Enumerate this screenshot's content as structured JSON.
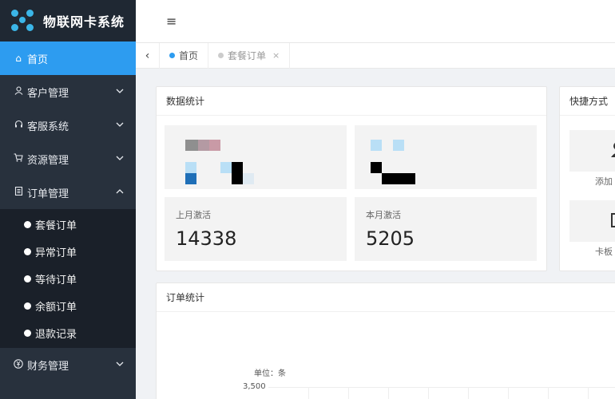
{
  "app": {
    "title": "物联网卡系统"
  },
  "sidebar": {
    "items": [
      {
        "label": "首页",
        "icon": "home-icon",
        "active": true
      },
      {
        "label": "客户管理",
        "icon": "user-icon"
      },
      {
        "label": "客服系统",
        "icon": "headset-icon"
      },
      {
        "label": "资源管理",
        "icon": "cart-icon"
      },
      {
        "label": "订单管理",
        "icon": "document-icon",
        "expanded": true
      },
      {
        "label": "财务管理",
        "icon": "yen-icon"
      }
    ],
    "order_submenu": [
      "套餐订单",
      "异常订单",
      "等待订单",
      "余额订单",
      "退款记录"
    ]
  },
  "tabs": [
    {
      "label": "首页",
      "active": true
    },
    {
      "label": "套餐订单",
      "active": false,
      "close": "×"
    }
  ],
  "stats": {
    "title": "数据统计",
    "last_month": {
      "label": "上月激活",
      "value": "14338"
    },
    "this_month": {
      "label": "本月激活",
      "value": "5205"
    }
  },
  "quick": {
    "title": "快捷方式",
    "items": [
      {
        "label": "添加",
        "icon": "add-user-icon"
      },
      {
        "label": "卡板",
        "icon": "folder-icon"
      }
    ]
  },
  "orders": {
    "title": "订单统计",
    "unit": "单位：条",
    "ytick": "3,500"
  },
  "colors": {
    "accent": "#2d9cf0",
    "sidebar": "#28313d",
    "submenu": "#1a2029"
  }
}
